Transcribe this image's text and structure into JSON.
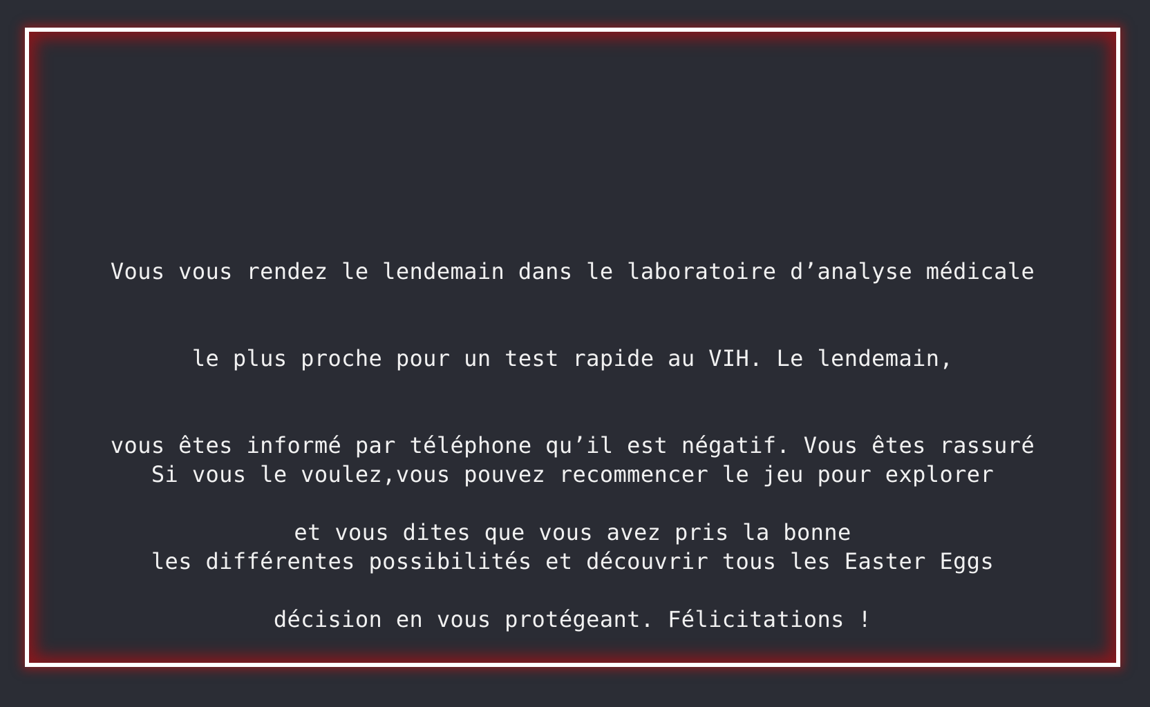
{
  "screen": {
    "border_color": "#ffffff",
    "glow_color": "#a0141c",
    "background_color": "#2a2c34",
    "text_color": "#f1f1f1"
  },
  "message": {
    "paragraph_1": [
      "Vous vous rendez le lendemain dans le laboratoire d’analyse médicale",
      "le plus proche pour un test rapide au VIH. Le lendemain,",
      "vous êtes informé par téléphone qu’il est négatif. Vous êtes rassuré",
      "et vous dites que vous avez pris la bonne",
      "décision en vous protégeant. Félicitations !"
    ],
    "paragraph_2": [
      "Si vous le voulez,vous pouvez recommencer le jeu pour explorer",
      "les différentes possibilités et découvrir tous les Easter Eggs"
    ]
  }
}
